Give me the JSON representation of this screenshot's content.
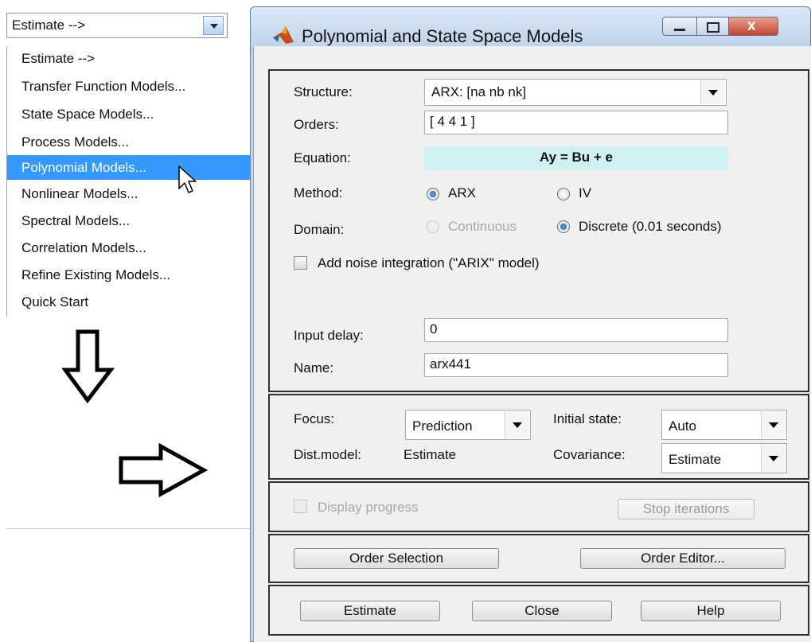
{
  "left_menu": {
    "combo_value": "Estimate -->",
    "items": [
      {
        "label": "Estimate -->"
      },
      {
        "label": "Transfer Function Models..."
      },
      {
        "label": "State Space Models..."
      },
      {
        "label": "Process Models..."
      },
      {
        "label": "Polynomial Models..."
      },
      {
        "label": "Nonlinear Models..."
      },
      {
        "label": "Spectral Models..."
      },
      {
        "label": "Correlation Models..."
      },
      {
        "label": "Refine Existing Models..."
      },
      {
        "label": "Quick Start"
      }
    ],
    "selected_index": 4
  },
  "dialog": {
    "title": "Polynomial and State Space Models",
    "close_glyph": "x",
    "structure": {
      "label": "Structure:",
      "value": "ARX: [na nb nk]"
    },
    "orders": {
      "label": "Orders:",
      "value": "[ 4 4 1 ]"
    },
    "equation": {
      "label": "Equation:",
      "value": "Ay = Bu + e"
    },
    "method": {
      "label": "Method:",
      "option_arx": "ARX",
      "option_iv": "IV",
      "selected": "ARX"
    },
    "domain": {
      "label": "Domain:",
      "option_continuous": "Continuous",
      "option_discrete": "Discrete (0.01 seconds)",
      "selected": "Discrete"
    },
    "noise_integration": {
      "label": "Add noise integration (\"ARIX\" model)",
      "checked": false
    },
    "input_delay": {
      "label": "Input delay:",
      "value": "0"
    },
    "name": {
      "label": "Name:",
      "value": "arx441"
    },
    "focus": {
      "label": "Focus:",
      "value": "Prediction"
    },
    "initial_state": {
      "label": "Initial state:",
      "value": "Auto"
    },
    "dist_model": {
      "label": "Dist.model:",
      "value": "Estimate"
    },
    "covariance": {
      "label": "Covariance:",
      "value": "Estimate"
    },
    "display_progress": {
      "label": "Display progress",
      "checked": false
    },
    "stop_iterations_label": "Stop iterations",
    "order_selection_label": "Order Selection",
    "order_editor_label": "Order Editor...",
    "estimate_label": "Estimate",
    "close_label": "Close",
    "help_label": "Help"
  },
  "icons": {
    "app": "matlab-logo-icon",
    "cursor": "mouse-pointer-icon",
    "arrow_down": "outline-arrow-down-icon",
    "arrow_right": "outline-arrow-right-icon"
  }
}
